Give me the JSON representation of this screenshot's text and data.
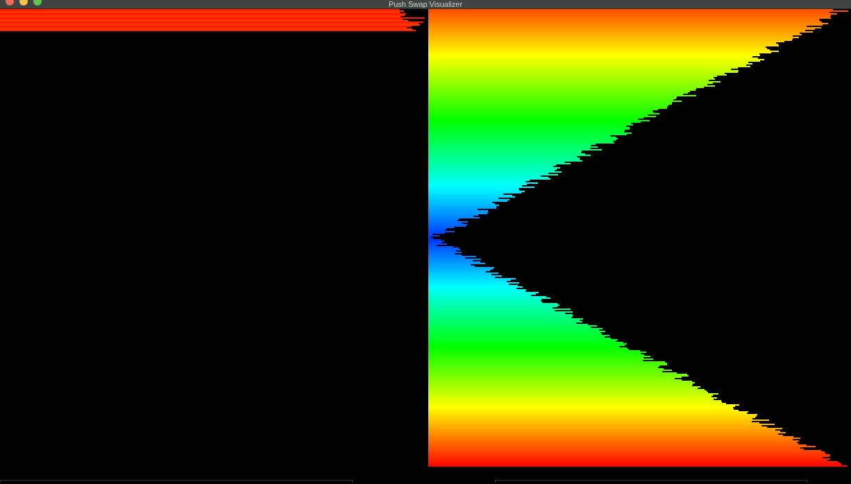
{
  "window": {
    "title": "Push Swap Visualizer"
  }
}
